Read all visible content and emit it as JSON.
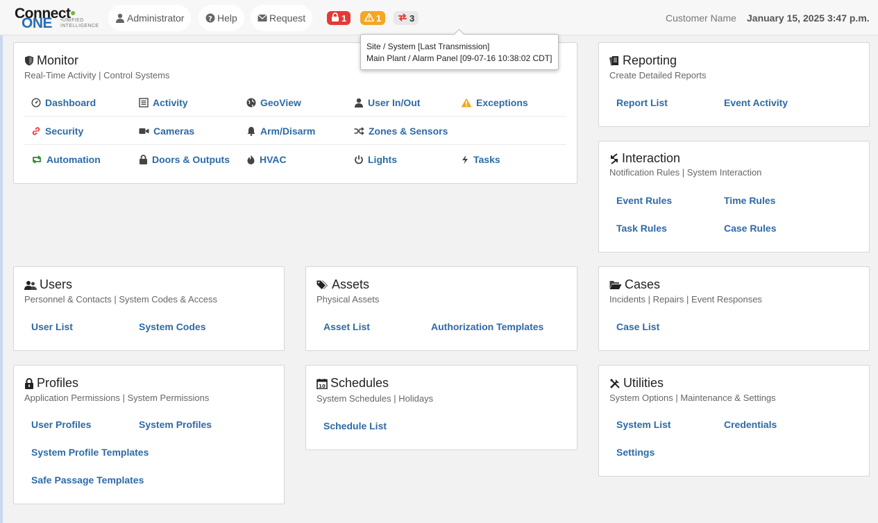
{
  "header": {
    "logo": {
      "word1": "Connect",
      "word2": "ONE",
      "tag1": "UNIFIED",
      "tag2": "INTELLIGENCE"
    },
    "nav": [
      {
        "label": "Administrator",
        "icon": "user-icon"
      },
      {
        "label": "Help",
        "icon": "question-circle-icon"
      },
      {
        "label": "Request",
        "icon": "envelope-icon"
      }
    ],
    "badges": {
      "alarms": {
        "count": "1",
        "icon": "lock-icon",
        "color": "#e53935"
      },
      "warnings": {
        "count": "1",
        "icon": "warning-icon",
        "color": "#f5a623"
      },
      "transmissions": {
        "count": "3",
        "icon": "exchange-icon",
        "color": "#e53935"
      }
    },
    "customer": "Customer Name",
    "datetime": "January 15, 2025 3:47 p.m."
  },
  "tooltip": {
    "line1": "Site / System [Last Transmission]",
    "line2": "Main Plant / Alarm Panel [09-07-16 10:38:02 CDT]"
  },
  "panels": {
    "monitor": {
      "title": "Monitor",
      "icon": "shield-icon",
      "subtitle": "Real-Time Activity | Control Systems",
      "links": [
        {
          "label": "Dashboard",
          "icon": "dashboard-icon"
        },
        {
          "label": "Activity",
          "icon": "list-icon"
        },
        {
          "label": "GeoView",
          "icon": "globe-icon"
        },
        {
          "label": "User In/Out",
          "icon": "user-icon"
        },
        {
          "label": "Exceptions",
          "icon": "warning-icon"
        },
        {
          "label": "Security",
          "icon": "link-icon"
        },
        {
          "label": "Cameras",
          "icon": "video-camera-icon"
        },
        {
          "label": "Arm/Disarm",
          "icon": "bell-icon"
        },
        {
          "label": "Zones & Sensors",
          "icon": "random-icon"
        },
        {
          "label": "Automation",
          "icon": "retweet-icon"
        },
        {
          "label": "Doors & Outputs",
          "icon": "lock-icon"
        },
        {
          "label": "HVAC",
          "icon": "fire-icon"
        },
        {
          "label": "Lights",
          "icon": "power-icon"
        },
        {
          "label": "Tasks",
          "icon": "bolt-icon"
        }
      ]
    },
    "reporting": {
      "title": "Reporting",
      "icon": "document-icon",
      "subtitle": "Create Detailed Reports",
      "links": [
        {
          "label": "Report List"
        },
        {
          "label": "Event Activity"
        }
      ]
    },
    "interaction": {
      "title": "Interaction",
      "icon": "exchange-vertical-icon",
      "subtitle": "Notification Rules | System Interaction",
      "links": [
        {
          "label": "Event Rules"
        },
        {
          "label": "Time Rules"
        },
        {
          "label": "Task Rules"
        },
        {
          "label": "Case Rules"
        }
      ]
    },
    "users": {
      "title": "Users",
      "icon": "users-icon",
      "subtitle": "Personnel & Contacts | System Codes & Access",
      "links": [
        {
          "label": "User List"
        },
        {
          "label": "System Codes"
        }
      ]
    },
    "assets": {
      "title": "Assets",
      "icon": "tags-icon",
      "subtitle": "Physical Assets",
      "links": [
        {
          "label": "Asset List"
        },
        {
          "label": "Authorization Templates"
        }
      ]
    },
    "cases": {
      "title": "Cases",
      "icon": "folder-open-icon",
      "subtitle": "Incidents | Repairs | Event Responses",
      "links": [
        {
          "label": "Case List"
        }
      ]
    },
    "profiles": {
      "title": "Profiles",
      "icon": "lock-icon",
      "subtitle": "Application Permissions | System Permissions",
      "links": [
        {
          "label": "User Profiles"
        },
        {
          "label": "System Profiles"
        },
        {
          "label": "System Profile Templates"
        },
        {
          "label": "Safe Passage Templates"
        }
      ]
    },
    "schedules": {
      "title": "Schedules",
      "icon": "calendar-icon",
      "subtitle": "System Schedules | Holidays",
      "links": [
        {
          "label": "Schedule List"
        }
      ]
    },
    "utilities": {
      "title": "Utilities",
      "icon": "tools-icon",
      "subtitle": "System Options | Maintenance & Settings",
      "links": [
        {
          "label": "System List"
        },
        {
          "label": "Credentials"
        },
        {
          "label": "Settings"
        }
      ]
    }
  }
}
